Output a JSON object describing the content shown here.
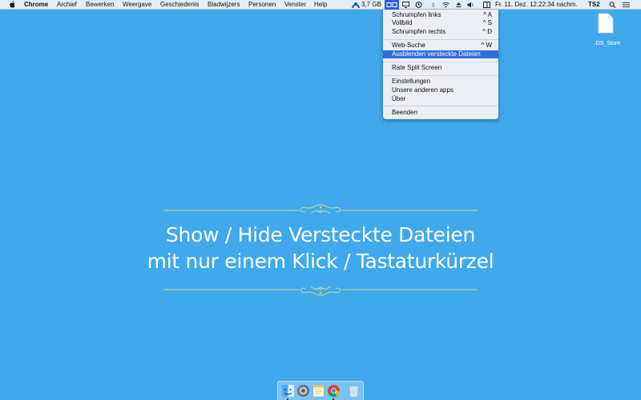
{
  "menubar": {
    "app_name": "Chrome",
    "menus": [
      "Archief",
      "Bewerken",
      "Weergave",
      "Geschiedenis",
      "Bladwijzers",
      "Personen",
      "Venster",
      "Help"
    ],
    "memory": "3,7 GB",
    "datetime": "Fr. 11. Dez.  12:22:34 nachm.",
    "user": "TS2"
  },
  "dropdown": {
    "items": [
      {
        "label": "Schrumpfen links",
        "shortcut": "^ A"
      },
      {
        "label": "Vollbild",
        "shortcut": "^ S"
      },
      {
        "label": "Schrumpfen rechts",
        "shortcut": "^ D"
      },
      {
        "label": "Web-Suche",
        "shortcut": "^ W"
      },
      {
        "label": "Ausblenden versteckte Dateien",
        "shortcut": ""
      },
      {
        "label": "Rate Split Screen",
        "shortcut": ""
      },
      {
        "label": "Einstellungen",
        "shortcut": ""
      },
      {
        "label": "Unsere anderen apps",
        "shortcut": ""
      },
      {
        "label": "Über",
        "shortcut": ""
      },
      {
        "label": "Beenden",
        "shortcut": ""
      }
    ]
  },
  "desktop": {
    "file_name": ".DS_Store"
  },
  "promo": {
    "line1": "Show / Hide Versteckte Dateien",
    "line2": "mit nur einem Klick / Tastaturkürzel"
  },
  "dock": {
    "apps": [
      "finder-icon",
      "system-preferences-icon",
      "notes-icon",
      "chrome-icon",
      "trash-icon"
    ]
  },
  "colors": {
    "desktop_background": "#3fa9ec",
    "highlight": "#2f6cdc",
    "ornament": "#c9d98a"
  }
}
